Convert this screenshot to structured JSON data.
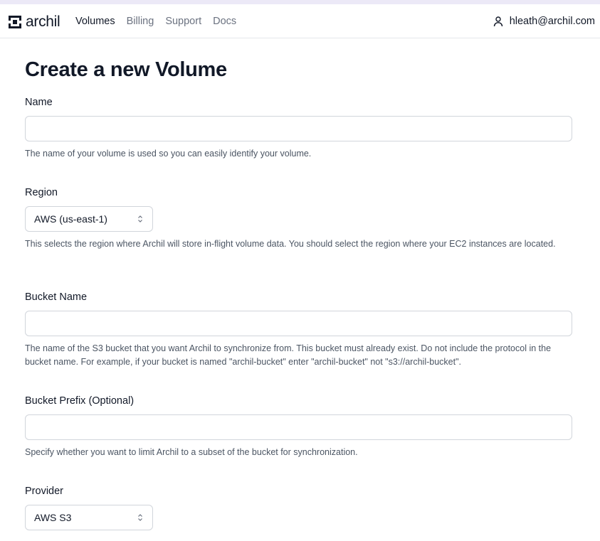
{
  "app": {
    "logo_text": "archil"
  },
  "nav": {
    "items": [
      {
        "label": "Volumes",
        "active": true
      },
      {
        "label": "Billing",
        "active": false
      },
      {
        "label": "Support",
        "active": false
      },
      {
        "label": "Docs",
        "active": false
      }
    ]
  },
  "user": {
    "email": "hleath@archil.com",
    "icon": "user-icon"
  },
  "page": {
    "title": "Create a new Volume"
  },
  "form": {
    "name": {
      "label": "Name",
      "value": "",
      "help": "The name of your volume is used so you can easily identify your volume."
    },
    "region": {
      "label": "Region",
      "selected": "AWS (us-east-1)",
      "help": "This selects the region where Archil will store in-flight volume data. You should select the region where your EC2 instances are located."
    },
    "bucket_name": {
      "label": "Bucket Name",
      "value": "",
      "help": "The name of the S3 bucket that you want Archil to synchronize from. This bucket must already exist. Do not include the protocol in the bucket name. For example, if your bucket is named \"archil-bucket\" enter \"archil-bucket\" not \"s3://archil-bucket\"."
    },
    "bucket_prefix": {
      "label": "Bucket Prefix (Optional)",
      "value": "",
      "help": "Specify whether you want to limit Archil to a subset of the bucket for synchronization."
    },
    "provider": {
      "label": "Provider",
      "selected": "AWS S3"
    }
  },
  "colors": {
    "accent_strip": "#ece9f7",
    "text_primary": "#111827",
    "text_muted": "#6b7280",
    "border": "#d1d5db"
  }
}
